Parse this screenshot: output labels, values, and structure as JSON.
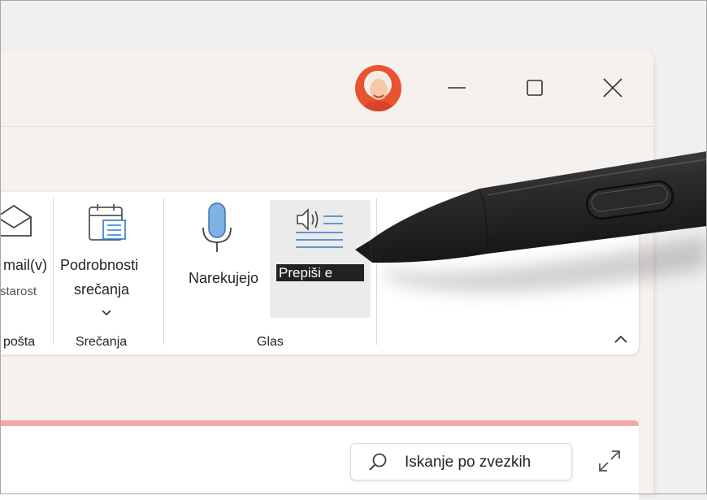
{
  "titlebar": {
    "avatar": "user-avatar",
    "minimize_icon": "minimize-icon",
    "maximize_icon": "maximize-icon",
    "close_icon": "close-icon"
  },
  "ribbon": {
    "mail": {
      "label_line1": "mail(v)",
      "label_line2": "starost",
      "group_label": "pošta",
      "icon": "envelope-icon"
    },
    "meeting": {
      "label_line1": "Podrobnosti",
      "label_line2": "srečanja",
      "group_label": "Srečanja",
      "icon": "calendar-details-icon",
      "chevron_icon": "chevron-down-icon"
    },
    "voice": {
      "dictate_label": "Narekujejo",
      "transcribe_label": "Prepiši e",
      "group_label": "Glas",
      "mic_icon": "microphone-icon",
      "transcribe_icon": "transcribe-icon"
    },
    "collapse_icon": "chevron-up-icon"
  },
  "search": {
    "placeholder": "Iskanje po zvezkih",
    "icon": "search-icon"
  },
  "expand_icon": "expand-icon",
  "colors": {
    "accent_pink": "#f0a9a6",
    "mic_blue": "#7fb2e5",
    "transcribe_blue": "#2c7bd0"
  }
}
